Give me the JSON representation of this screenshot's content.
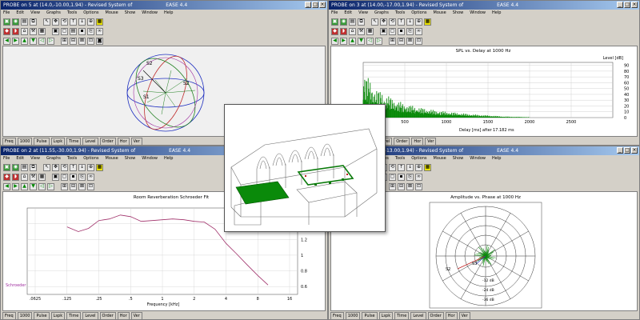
{
  "windows": {
    "tl": {
      "title": "PROBE on 5 at (14.0,-10.00,1.94) - Revised System of",
      "app": "EASE 4.4"
    },
    "tr": {
      "title": "PROBE on 3 at (14.00,-17.00,1.94) - Revised System of",
      "app": "EASE 4.4"
    },
    "bl": {
      "title": "PROBE on 2 at (11.55,-30.00,1.94) - Revised System of",
      "app": "EASE 4.4"
    },
    "br": {
      "title": "PROBE on 4 at (14.00,-13.00,1.94) - Revised System of",
      "app": "EASE 4.4"
    }
  },
  "menu": [
    "File",
    "Edit",
    "View",
    "Graphs",
    "Tools",
    "Options",
    "Mouse",
    "Show",
    "Window",
    "Help"
  ],
  "status": [
    "Freq",
    "1000",
    "Pulse",
    "Lspk",
    "Time",
    "Level",
    "Order",
    "Hor",
    "Ver"
  ],
  "status_tl": [
    "Freq",
    "1000",
    "Pulse",
    "Lspk",
    "Time",
    "Level",
    "Order",
    "Hor",
    "Ver"
  ],
  "status_tr": [
    "Level",
    "Order",
    "Hor",
    "Ver"
  ],
  "sphere": {
    "labels": [
      "S2",
      "S3",
      "S1",
      "S2"
    ]
  },
  "spl_chart": {
    "title": "SPL vs. Delay at 1000 Hz",
    "level_label": "Level [dB]",
    "xlabel": "Delay [ms] after",
    "xlabel_value": "17.182 ms",
    "marker": "S3",
    "sub_marker": "(65)"
  },
  "rev_chart": {
    "title": "Room Reverberation Schroeder Fit",
    "xlabel": "Frequency [kHz]",
    "legend": "Schroeder"
  },
  "polar_chart": {
    "title": "Amplitude vs. Phase at 1000 Hz",
    "labels": [
      "S2",
      "S3",
      "-12 dB",
      "-24 dB",
      "-36 dB"
    ]
  },
  "chart_data": [
    {
      "type": "bar",
      "title": "SPL vs. Delay at 1000 Hz",
      "xlabel": "Delay [ms] after 17.182 ms",
      "ylabel": "Level [dB]",
      "x_ticks": [
        500,
        1000,
        1500,
        2000,
        2500
      ],
      "y_ticks": [
        90,
        80,
        70,
        60,
        50,
        40,
        30,
        20,
        10,
        0
      ],
      "xlim": [
        0,
        3000
      ],
      "ylim": [
        0,
        95
      ],
      "envelope": [
        [
          0,
          88
        ],
        [
          50,
          72
        ],
        [
          100,
          58
        ],
        [
          200,
          46
        ],
        [
          300,
          38
        ],
        [
          400,
          30
        ],
        [
          500,
          24
        ],
        [
          700,
          17
        ],
        [
          900,
          12
        ],
        [
          1100,
          9
        ],
        [
          1300,
          6
        ],
        [
          1500,
          4
        ],
        [
          1700,
          2
        ],
        [
          2000,
          1
        ]
      ]
    },
    {
      "type": "line",
      "title": "Room Reverberation Schroeder Fit",
      "xlabel": "Frequency [kHz]",
      "x_ticks": [
        ".0625",
        ".125",
        ".25",
        ".5",
        "1",
        "2",
        "4",
        "8",
        "16"
      ],
      "y_ticks": [
        1.4,
        1.2,
        1,
        0.8,
        0.6
      ],
      "ylim": [
        0.5,
        1.6
      ],
      "series": [
        {
          "name": "Schroeder",
          "x": [
            0.125,
            0.16,
            0.2,
            0.25,
            0.315,
            0.4,
            0.5,
            0.63,
            0.8,
            1,
            1.25,
            1.6,
            2,
            2.5,
            3.15,
            4,
            5,
            6.3,
            8,
            10
          ],
          "values": [
            1.36,
            1.3,
            1.34,
            1.44,
            1.46,
            1.51,
            1.49,
            1.43,
            1.44,
            1.45,
            1.46,
            1.45,
            1.43,
            1.42,
            1.33,
            1.15,
            1.02,
            0.88,
            0.74,
            0.62
          ]
        }
      ]
    },
    {
      "type": "scatter",
      "title": "Amplitude vs. Phase at 1000 Hz",
      "rings": [
        "-12 dB",
        "-24 dB",
        "-36 dB"
      ]
    }
  ]
}
